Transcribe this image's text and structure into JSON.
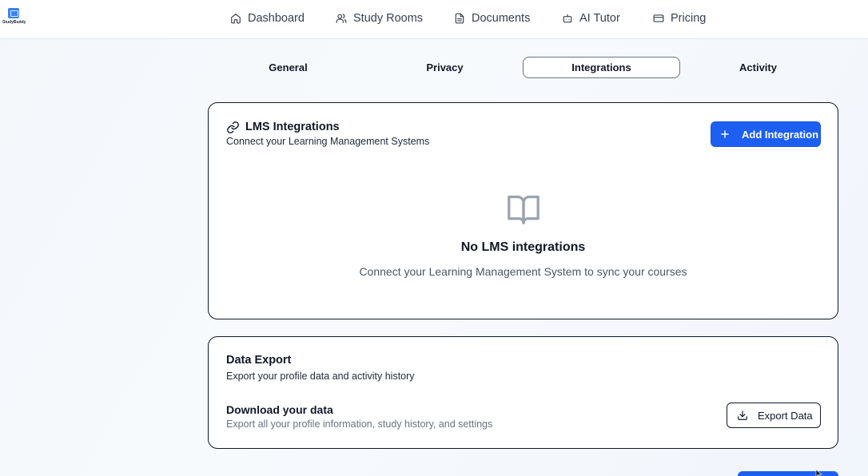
{
  "app": {
    "logo_text": "StudyBuddy"
  },
  "nav": {
    "items": [
      {
        "label": "Dashboard",
        "icon": "home-icon"
      },
      {
        "label": "Study Rooms",
        "icon": "users-icon"
      },
      {
        "label": "Documents",
        "icon": "document-icon"
      },
      {
        "label": "AI Tutor",
        "icon": "bot-icon"
      },
      {
        "label": "Pricing",
        "icon": "credit-card-icon"
      }
    ]
  },
  "tabs": [
    {
      "label": "General",
      "active": false
    },
    {
      "label": "Privacy",
      "active": false
    },
    {
      "label": "Integrations",
      "active": true
    },
    {
      "label": "Activity",
      "active": false
    }
  ],
  "lms": {
    "title": "LMS Integrations",
    "subtitle": "Connect your Learning Management Systems",
    "add_button": "Add Integration",
    "empty_title": "No LMS integrations",
    "empty_subtitle": "Connect your Learning Management System to sync your courses"
  },
  "export": {
    "title": "Data Export",
    "subtitle": "Export your profile data and activity history",
    "row_title": "Download your data",
    "row_subtitle": "Export all your profile information, study history, and settings",
    "button": "Export Data"
  },
  "colors": {
    "primary": "#1d5ff2",
    "border": "#111827"
  }
}
